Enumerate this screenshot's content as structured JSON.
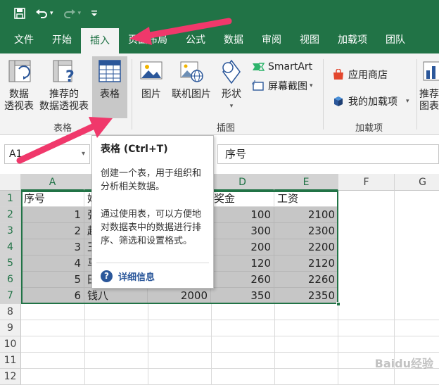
{
  "qat": {
    "save": "save-icon",
    "undo": "undo-icon",
    "redo": "redo-icon",
    "customize": "customize-icon"
  },
  "tabs": [
    {
      "label": "文件"
    },
    {
      "label": "开始"
    },
    {
      "label": "插入"
    },
    {
      "label": "页面布局"
    },
    {
      "label": "公式"
    },
    {
      "label": "数据"
    },
    {
      "label": "审阅"
    },
    {
      "label": "视图"
    },
    {
      "label": "加载项"
    },
    {
      "label": "团队"
    }
  ],
  "ribbon": {
    "pivot_line1": "数据",
    "pivot_line2": "透视表",
    "rec_pivot_line1": "推荐的",
    "rec_pivot_line2": "数据透视表",
    "table": "表格",
    "group_tables": "表格",
    "picture": "图片",
    "online_picture": "联机图片",
    "shapes": "形状",
    "smartart": "SmartArt",
    "screenshot": "屏幕截图",
    "group_illustrations": "插图",
    "store": "应用商店",
    "my_addins": "我的加载项",
    "group_addins": "加载项",
    "rec_chart_line1": "推荐",
    "rec_chart_line2": "图表"
  },
  "formula_bar": {
    "name_box": "A1",
    "formula": "序号"
  },
  "grid": {
    "columns": [
      "A",
      "B",
      "C",
      "D",
      "E",
      "F",
      "G"
    ],
    "rows": [
      "1",
      "2",
      "3",
      "4",
      "5",
      "6",
      "7",
      "8",
      "9",
      "10",
      "11",
      "12"
    ],
    "cells": {
      "A1": "序号",
      "B1": "姓",
      "D1": "奖金",
      "E1": "工资",
      "A2": "1",
      "B2": "张",
      "D2": "100",
      "E2": "2100",
      "A3": "2",
      "B3": "赵",
      "D3": "300",
      "E3": "2300",
      "A4": "3",
      "B4": "王",
      "D4": "200",
      "E4": "2200",
      "A5": "4",
      "B5": "马",
      "D5": "120",
      "E5": "2120",
      "A6": "5",
      "B6": "田",
      "D6": "260",
      "E6": "2260",
      "A7": "6",
      "B7": "钱八",
      "C7": "2000",
      "D7": "350",
      "E7": "2350"
    }
  },
  "tooltip": {
    "title": "表格 (Ctrl+T)",
    "desc1": "创建一个表，用于组织和分析相关数据。",
    "desc2": "通过使用表，可以方便地对数据表中的数据进行排序、筛选和设置格式。",
    "more_info": "详细信息"
  },
  "colors": {
    "accent": "#217346",
    "arrow": "#f0386b",
    "help": "#2b579a"
  },
  "watermark": "Baidu经验"
}
